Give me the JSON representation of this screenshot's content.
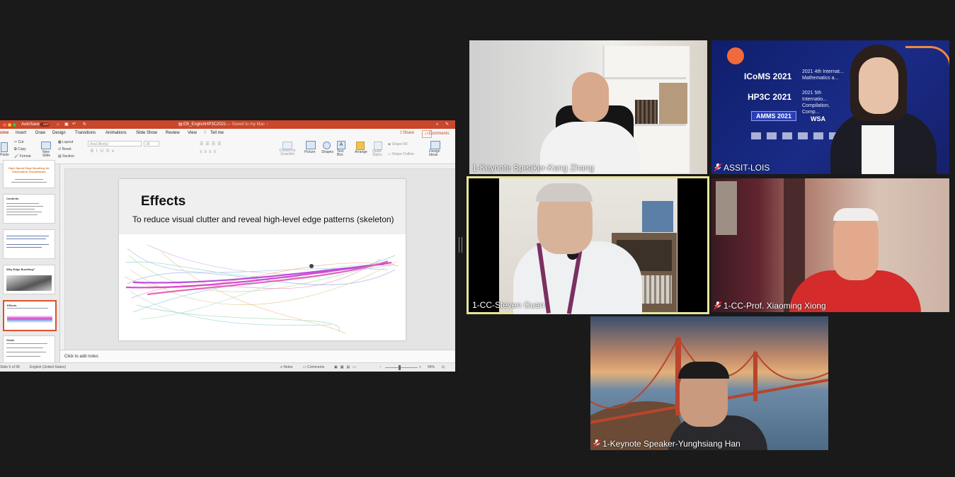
{
  "ppt": {
    "autosave": "AutoSave",
    "autosave_state": "OFF",
    "title": "EB_EnglishHP3C2021",
    "saved": " — Saved to my Mac ~",
    "tabs": [
      "ome",
      "Insert",
      "Draw",
      "Design",
      "Transitions",
      "Animations",
      "Slide Show",
      "Review",
      "View"
    ],
    "tell_me": "Tell me",
    "share": "Share",
    "comments": "Comments",
    "ribbon": {
      "paste": "Paste",
      "cut": "Cut",
      "copy": "Copy",
      "format": "Format",
      "new_slide": "New Slide",
      "layout": "Layout",
      "reset": "Reset",
      "section": "Section",
      "font": "Arial (Body)",
      "size": "28",
      "convert": "Convert to SmartArt",
      "picture": "Picture",
      "shapes": "Shapes",
      "text_box": "Text Box",
      "arrange": "Arrange",
      "quick_styles": "Quick Styles",
      "shape_fill": "Shape Fill",
      "shape_outline": "Shape Outline",
      "design_ideas": "Design Ideas"
    },
    "thumbs": [
      {
        "title": "High Speed Edge Bundling for Information Visualization"
      },
      {
        "title": "Contents"
      },
      {
        "title": ""
      },
      {
        "title": "Why Edge Bundling?"
      },
      {
        "title": "Effects"
      },
      {
        "title": "Goals"
      }
    ],
    "slide": {
      "title": "Effects",
      "subtitle": "To reduce visual clutter and reveal high-level edge patterns (skeleton)"
    },
    "notes": "Click to add notes",
    "status": {
      "slide": "Slide 5 of 58",
      "language": "English (United States)",
      "notes": "Notes",
      "comments": "Comments",
      "zoom": "94%"
    }
  },
  "participants": [
    {
      "name": "1-Keynote Speaker-Kang Zhang",
      "muted": false
    },
    {
      "name": "ASSIT-LOIS",
      "muted": true
    },
    {
      "name": "1-CC-Steven Guan",
      "muted": false,
      "active_speaker": true
    },
    {
      "name": "1-CC-Prof. Xiaoming Xiong",
      "muted": true
    },
    {
      "name": "1-Keynote Speaker-Yunghsiang Han",
      "muted": true
    }
  ],
  "banner": {
    "icoms": "ICoMS 2021",
    "icoms_desc": "2021 4th Internat... Mathematics a...",
    "hp3c": "HP3C 2021",
    "hp3c_desc": "2021 5th Internatio... Compilation, Comp...",
    "amms": "AMMS 2021",
    "wsa": "WSA"
  },
  "colors": {
    "ppt_accent": "#c9472b",
    "active_border": "#e8e59a",
    "mute_red": "#e02828"
  }
}
